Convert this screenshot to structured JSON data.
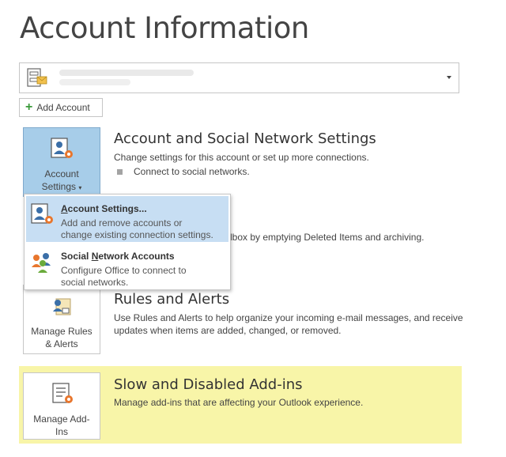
{
  "page": {
    "title": "Account Information"
  },
  "account_selector": {
    "value": "",
    "caret_icon": "dropdown-caret-icon"
  },
  "add_account": {
    "label": "Add Account",
    "icon": "plus-icon"
  },
  "account_settings": {
    "button_label_line1": "Account",
    "button_label_line2": "Settings",
    "title": "Account and Social Network Settings",
    "description": "Change settings for this account or set up more connections.",
    "bullet": "Connect to social networks.",
    "partial_text": "lbox by emptying Deleted Items and archiving."
  },
  "dropdown": {
    "items": [
      {
        "title_pre": "",
        "title_u": "A",
        "title_post": "ccount Settings...",
        "description_line1": "Add and remove accounts or",
        "description_line2": "change existing connection settings."
      },
      {
        "title_pre": "Social ",
        "title_u": "N",
        "title_post": "etwork Accounts",
        "description_line1": "Configure Office to connect to",
        "description_line2": "social networks."
      }
    ]
  },
  "rules_alerts": {
    "button_label_line1": "Manage Rules",
    "button_label_line2": "& Alerts",
    "title": "Rules and Alerts",
    "description_line1": "Use Rules and Alerts to help organize your incoming e-mail messages, and receive",
    "description_line2": "updates when items are added, changed, or removed."
  },
  "addins": {
    "button_label_line1": "Manage Add-",
    "button_label_line2": "Ins",
    "title": "Slow and Disabled Add-ins",
    "description": "Manage add-ins that are affecting your Outlook experience."
  },
  "colors": {
    "highlight": "#a7cde9",
    "addins_background": "#f8f5a8",
    "gear_orange": "#e8762d"
  }
}
